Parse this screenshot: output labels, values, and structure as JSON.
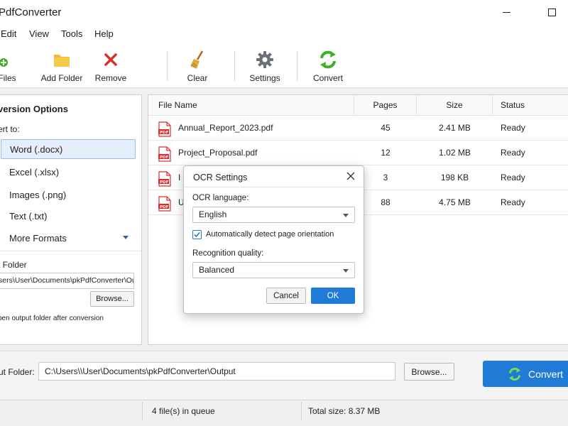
{
  "window": {
    "title": "PdfConverter"
  },
  "menu": [
    "Edit",
    "View",
    "Tools",
    "Help"
  ],
  "toolbar": {
    "add_files": "Files",
    "add_folder": "Add Folder",
    "remove": "Remove",
    "clear": "Clear",
    "settings": "Settings",
    "convert": "Convert"
  },
  "left_panel": {
    "title": "version Options",
    "convert_to": "ert to:",
    "formats": [
      "Word (.docx)",
      "Excel (.xlsx)",
      "Images (.png)",
      "Text (.txt)",
      "More Formats"
    ],
    "selected_format": "Word (.docx)",
    "output_folder_label": "t Folder",
    "output_folder_path": "sers\\User\\Documents\\pkPdfConverter\\Output",
    "browse": "Browse...",
    "open_after": "pen output folder after conversion"
  },
  "table": {
    "columns": [
      "File Name",
      "Pages",
      "Size",
      "Status"
    ],
    "rows": [
      {
        "name": "Annual_Report_2023.pdf",
        "pages": "45",
        "size": "2.41 MB",
        "status": "Ready"
      },
      {
        "name": "Project_Proposal.pdf",
        "pages": "12",
        "size": "1.02 MB",
        "status": "Ready"
      },
      {
        "name": "I",
        "pages": "3",
        "size": "198 KB",
        "status": "Ready"
      },
      {
        "name": "U",
        "pages": "88",
        "size": "4.75 MB",
        "status": "Ready"
      }
    ]
  },
  "bottom": {
    "output_label": "ut Folder:",
    "output_path": "C:\\Users\\\\User\\Documents\\pkPdfConverter\\Output",
    "browse": "Browse...",
    "convert": "Convert"
  },
  "status": {
    "queue": "4 file(s) in queue",
    "total": "Total size: 8.37 MB"
  },
  "dialog": {
    "title": "OCR Settings",
    "language_label": "OCR language:",
    "language_value": "English",
    "auto_detect_label": "Automatically detect page orientation",
    "auto_detect_checked": true,
    "quality_label": "Recognition quality:",
    "quality_value": "Balanced",
    "cancel": "Cancel",
    "ok": "OK"
  },
  "colors": {
    "accent": "#1f7bd6",
    "pdf_red": "#e0262b",
    "refresh_green": "#3fae2a"
  }
}
